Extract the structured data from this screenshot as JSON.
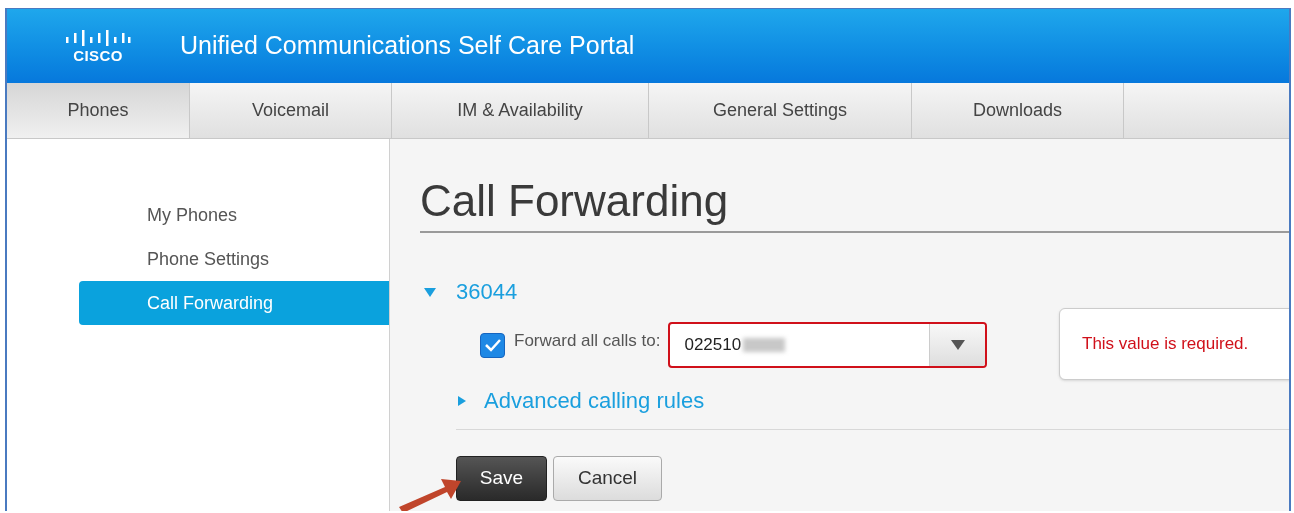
{
  "header": {
    "logo_text": "CISCO",
    "title": "Unified Communications Self Care Portal"
  },
  "tabs": [
    {
      "label": "Phones",
      "selected": true
    },
    {
      "label": "Voicemail",
      "selected": false
    },
    {
      "label": "IM & Availability",
      "selected": false
    },
    {
      "label": "General Settings",
      "selected": false
    },
    {
      "label": "Downloads",
      "selected": false
    }
  ],
  "sidebar": {
    "items": [
      {
        "label": "My Phones",
        "selected": false
      },
      {
        "label": "Phone Settings",
        "selected": false
      },
      {
        "label": "Call Forwarding",
        "selected": true
      }
    ]
  },
  "content": {
    "title": "Call Forwarding",
    "line": {
      "number": "36044",
      "expanded": true
    },
    "forward_all": {
      "label": "Forward all calls to:",
      "checked": true,
      "value": "022510",
      "error": "This value is required."
    },
    "advanced": {
      "label": "Advanced calling rules",
      "expanded": false
    },
    "buttons": [
      {
        "label": "Save",
        "kind": "primary"
      },
      {
        "label": "Cancel",
        "kind": "secondary"
      }
    ]
  }
}
